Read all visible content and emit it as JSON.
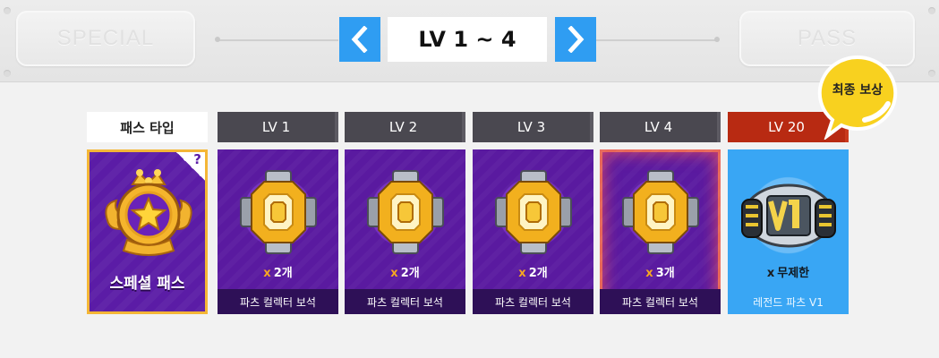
{
  "header": {
    "left_tab": "SPECIAL",
    "right_tab": "PASS",
    "level_range": "LV 1 ~ 4",
    "prev_icon": "chevron-left-icon",
    "next_icon": "chevron-right-icon"
  },
  "pass": {
    "type_label": "패스 타입",
    "name": "스페셜 패스",
    "help_mark": "?"
  },
  "final_badge": "최종 보상",
  "levels": [
    {
      "label": "LV 1",
      "qty_prefix": "x",
      "qty": "2개",
      "item": "파츠 컬렉터 보석"
    },
    {
      "label": "LV 2",
      "qty_prefix": "x",
      "qty": "2개",
      "item": "파츠 컬렉터 보석"
    },
    {
      "label": "LV 3",
      "qty_prefix": "x",
      "qty": "2개",
      "item": "파츠 컬렉터 보석"
    },
    {
      "label": "LV 4",
      "qty_prefix": "x",
      "qty": "3개",
      "item": "파츠 컬렉터 보석"
    },
    {
      "label": "LV 20",
      "qty_prefix": "x",
      "qty": "무제한",
      "item": "레전드 파츠 V1"
    }
  ],
  "colors": {
    "nav_blue": "#2f9df2",
    "card_purple": "#5a1aa0",
    "final_red": "#b82a12",
    "legend_blue": "#39a6f4",
    "gold": "#f4b636"
  }
}
